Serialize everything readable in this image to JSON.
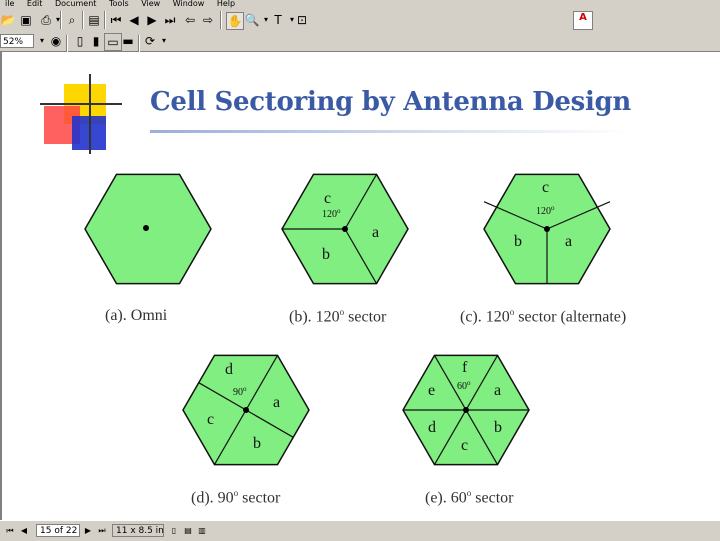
{
  "menubar": {
    "items": [
      "ile",
      "Edit",
      "Document",
      "Tools",
      "View",
      "Window",
      "Help"
    ]
  },
  "toolbar": {
    "zoom_value": "52%",
    "adobe_logo_text": "Adobe"
  },
  "slide": {
    "title": "Cell Sectoring by Antenna Design",
    "colors": {
      "title": "#3b5aa6",
      "hex_fill": "#80ee80",
      "deco_yellow": "#ffd700",
      "deco_red": "#ff3333",
      "deco_blue": "#2233cc"
    },
    "hexagons": [
      {
        "caption": "(a). Omni",
        "caption_sup": "",
        "caption_tail": "",
        "labels": [],
        "angle_label": ""
      },
      {
        "caption": "(b). 120",
        "caption_sup": "o",
        "caption_tail": " sector",
        "labels": [
          "c",
          "a",
          "b"
        ],
        "angle_label": "120",
        "angle_sup": "o"
      },
      {
        "caption": "(c). 120",
        "caption_sup": "o",
        "caption_tail": " sector (alternate)",
        "labels": [
          "c",
          "b",
          "a"
        ],
        "angle_label": "120",
        "angle_sup": "o"
      },
      {
        "caption": "(d). 90",
        "caption_sup": "o",
        "caption_tail": " sector",
        "labels": [
          "d",
          "a",
          "c",
          "b"
        ],
        "angle_label": "90",
        "angle_sup": "o"
      },
      {
        "caption": "(e). 60",
        "caption_sup": "o",
        "caption_tail": " sector",
        "labels": [
          "f",
          "e",
          "a",
          "d",
          "b",
          "c"
        ],
        "angle_label": "60",
        "angle_sup": "o"
      }
    ]
  },
  "statusbar": {
    "page_field": "15 of 22",
    "size_field": "11 x 8.5 in"
  }
}
